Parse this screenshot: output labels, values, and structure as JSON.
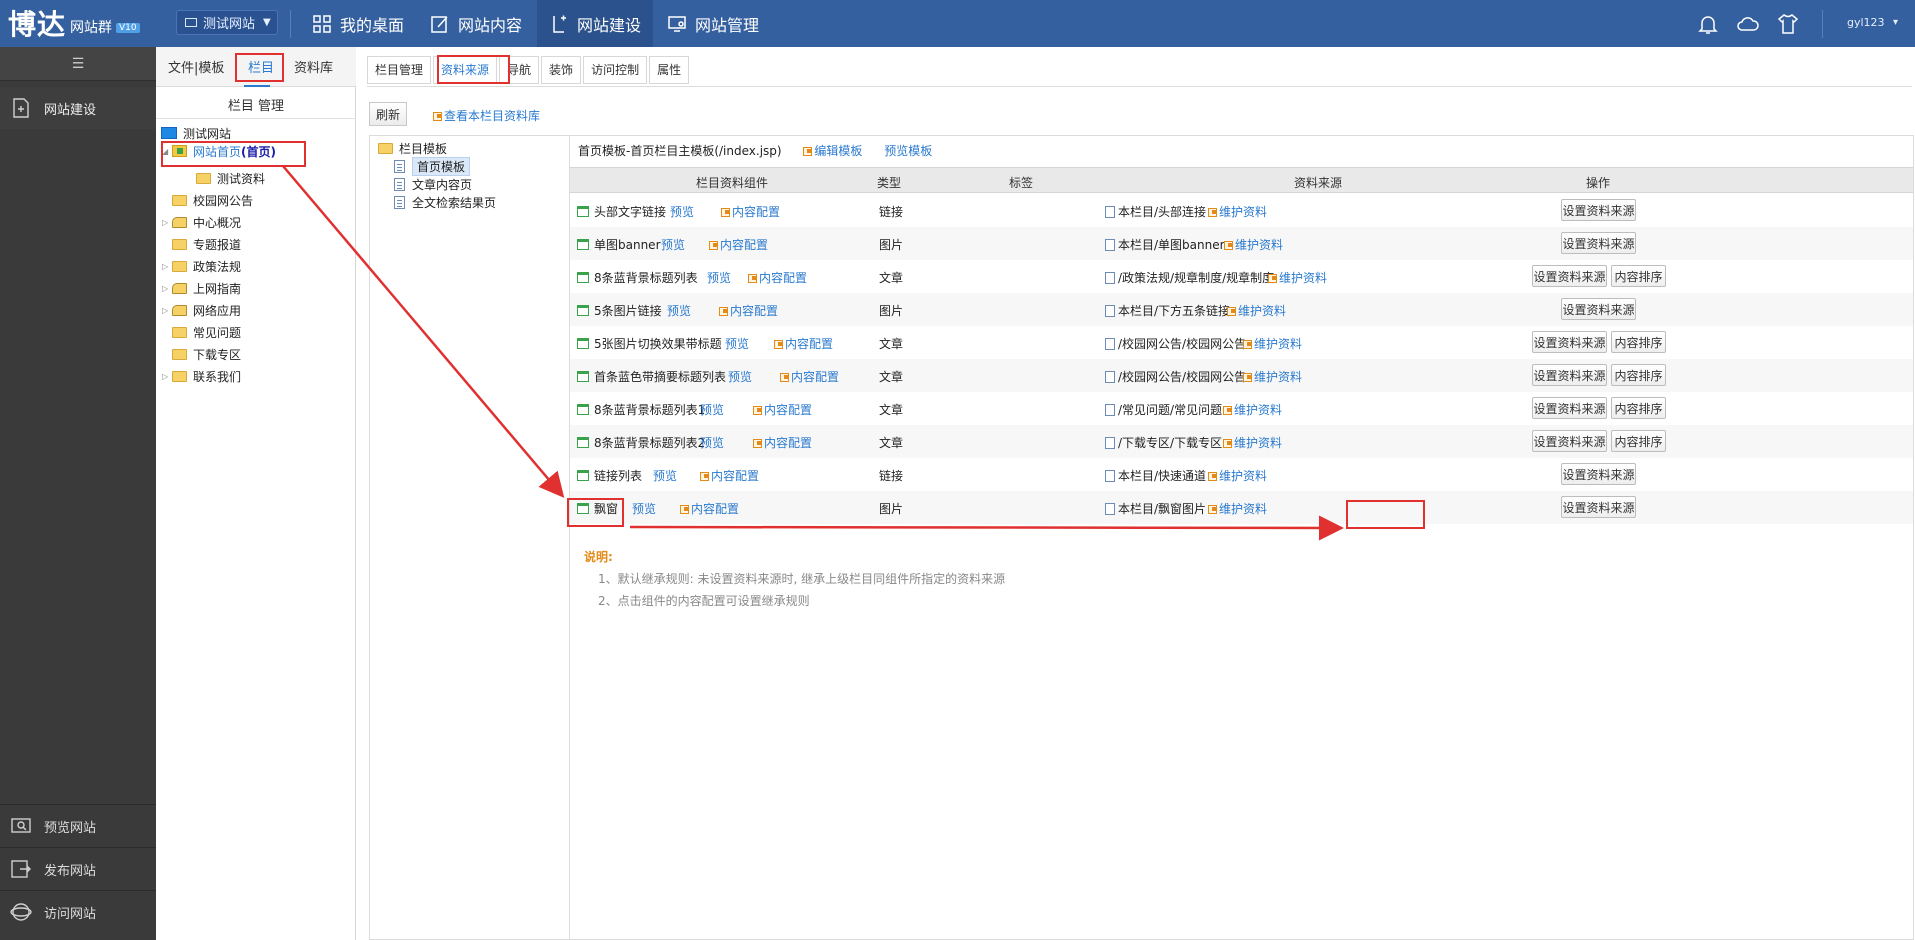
{
  "topbar": {
    "logo_big": "博达",
    "logo_small": "网站群",
    "logo_version": "V10",
    "site_select": "测试网站",
    "nav": [
      "我的桌面",
      "网站内容",
      "网站建设",
      "网站管理"
    ],
    "user": "gyl123"
  },
  "sidebar": {
    "main_item": "网站建设",
    "bottom_items": [
      "预览网站",
      "发布网站",
      "访问网站"
    ]
  },
  "tree": {
    "tabs": [
      "文件|模板",
      "栏目",
      "资料库"
    ],
    "title": "栏目 管理",
    "root": "测试网站",
    "home": "网站首页",
    "home_tag": "(首页)",
    "nodes": [
      "测试资料",
      "校园网公告",
      "中心概况",
      "专题报道",
      "政策法规",
      "上网指南",
      "网络应用",
      "常见问题",
      "下载专区",
      "联系我们"
    ]
  },
  "main": {
    "tabs": [
      "栏目管理",
      "资料来源",
      "导航",
      "装饰",
      "访问控制",
      "属性"
    ],
    "refresh": "刷新",
    "view_lib": "查看本栏目资料库",
    "templates": {
      "group": "栏目模板",
      "items": [
        "首页模板",
        "文章内容页",
        "全文检索结果页"
      ]
    },
    "tpl_info": {
      "text": "首页模板-首页栏目主模板(/index.jsp)",
      "edit": "编辑模板",
      "preview": "预览模板"
    },
    "headers": [
      "栏目资料组件",
      "类型",
      "标签",
      "资料来源",
      "操作"
    ],
    "rows": [
      {
        "name": "头部文字链接",
        "preview": "预览",
        "config": "内容配置",
        "type": "链接",
        "source": "本栏目/头部连接",
        "maintain": "维护资料",
        "btn1": "设置资料来源",
        "btn2": ""
      },
      {
        "name": "单图banner",
        "preview": "预览",
        "config": "内容配置",
        "type": "图片",
        "source": "本栏目/单图banner",
        "maintain": "维护资料",
        "btn1": "设置资料来源",
        "btn2": ""
      },
      {
        "name": "8条蓝背景标题列表",
        "preview": "预览",
        "config": "内容配置",
        "type": "文章",
        "source": "/政策法规/规章制度/规章制度",
        "maintain": "维护资料",
        "btn1": "设置资料来源",
        "btn2": "内容排序"
      },
      {
        "name": "5条图片链接",
        "preview": "预览",
        "config": "内容配置",
        "type": "图片",
        "source": "本栏目/下方五条链接",
        "maintain": "维护资料",
        "btn1": "设置资料来源",
        "btn2": ""
      },
      {
        "name": "5张图片切换效果带标题",
        "preview": "预览",
        "config": "内容配置",
        "type": "文章",
        "source": "/校园网公告/校园网公告",
        "maintain": "维护资料",
        "btn1": "设置资料来源",
        "btn2": "内容排序"
      },
      {
        "name": "首条蓝色带摘要标题列表",
        "preview": "预览",
        "config": "内容配置",
        "type": "文章",
        "source": "/校园网公告/校园网公告",
        "maintain": "维护资料",
        "btn1": "设置资料来源",
        "btn2": "内容排序"
      },
      {
        "name": "8条蓝背景标题列表1",
        "preview": "预览",
        "config": "内容配置",
        "type": "文章",
        "source": "/常见问题/常见问题",
        "maintain": "维护资料",
        "btn1": "设置资料来源",
        "btn2": "内容排序"
      },
      {
        "name": "8条蓝背景标题列表2",
        "preview": "预览",
        "config": "内容配置",
        "type": "文章",
        "source": "/下载专区/下载专区",
        "maintain": "维护资料",
        "btn1": "设置资料来源",
        "btn2": "内容排序"
      },
      {
        "name": "链接列表",
        "preview": "预览",
        "config": "内容配置",
        "type": "链接",
        "source": "本栏目/快速通道",
        "maintain": "维护资料",
        "btn1": "设置资料来源",
        "btn2": ""
      },
      {
        "name": "飘窗",
        "preview": "预览",
        "config": "内容配置",
        "type": "图片",
        "source": "本栏目/飘窗图片",
        "maintain": "维护资料",
        "btn1": "设置资料来源",
        "btn2": ""
      }
    ],
    "notes": {
      "title": "说明:",
      "lines": [
        "1、默认继承规则: 未设置资料来源时, 继承上级栏目同组件所指定的资料来源",
        "2、点击组件的内容配置可设置继承规则"
      ]
    }
  },
  "colors": {
    "topbar": "#35609f",
    "sidebar": "#3a3a3a",
    "link": "#2a7acf",
    "highlight": "#e03030",
    "note": "#e48a18"
  }
}
